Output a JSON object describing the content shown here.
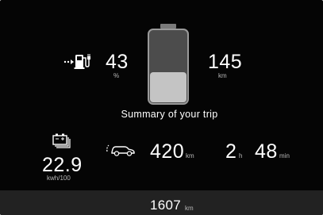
{
  "colors": {
    "background": "#050505",
    "footer_background": "#222222",
    "text": "#ffffff",
    "unit_text": "#b8b8b8",
    "battery_empty": "#4c4c4c",
    "battery_charged": "#c4c4c4"
  },
  "charge": {
    "value": "43",
    "unit": "%",
    "icon": "ev-charging-station-icon"
  },
  "range": {
    "value": "145",
    "unit": "km"
  },
  "battery_gauge": {
    "level_fraction": 0.42,
    "icon": "battery-gauge-icon"
  },
  "summary": {
    "title": "Summary of your trip",
    "efficiency": {
      "value": "22.9",
      "unit": "kwh/100",
      "icon": "battery-pack-icon"
    },
    "distance": {
      "value": "420",
      "unit": "km",
      "icon": "car-trip-icon"
    },
    "duration": {
      "hours": "2",
      "hours_unit": "h",
      "minutes": "48",
      "minutes_unit": "min"
    }
  },
  "odometer": {
    "value": "1607",
    "unit": "km"
  }
}
